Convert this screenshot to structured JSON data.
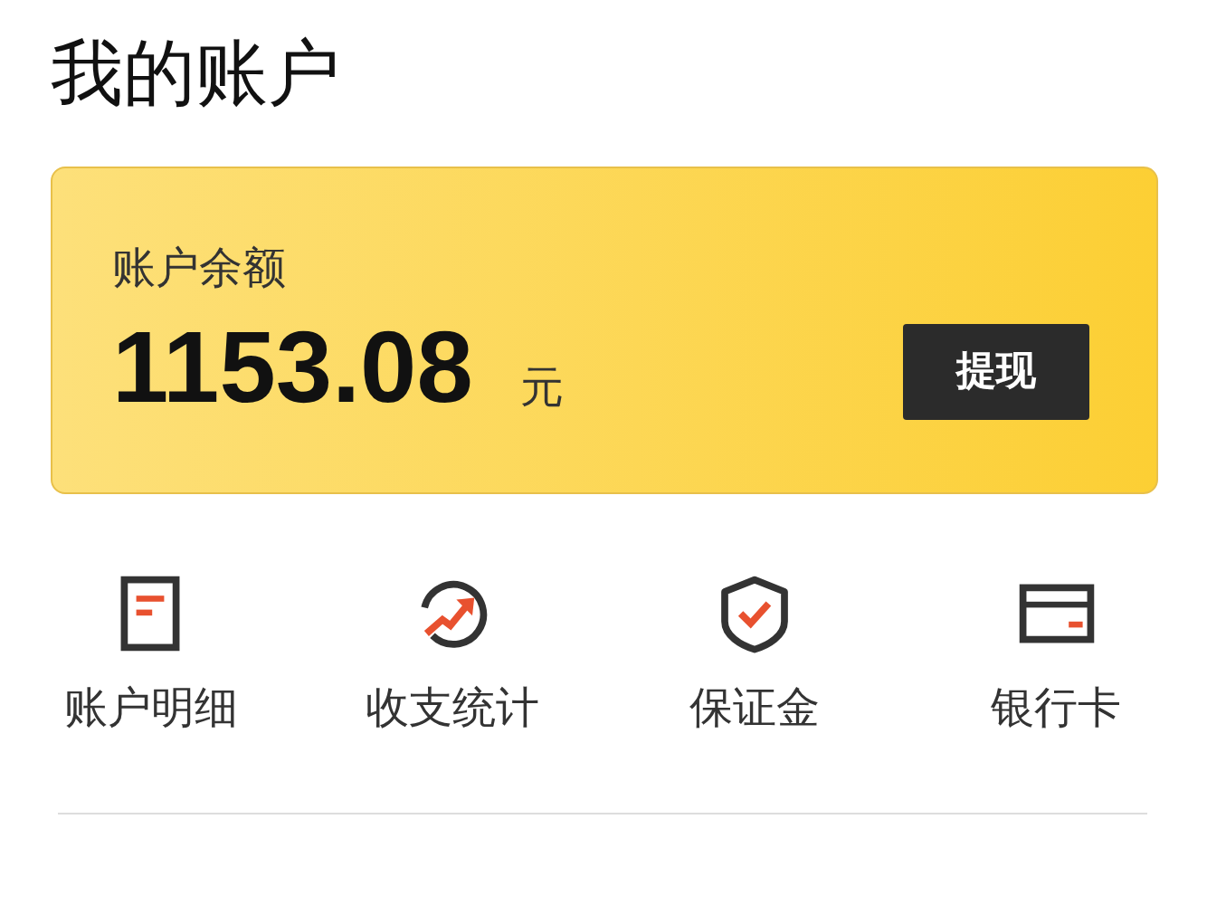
{
  "title": "我的账户",
  "balance": {
    "label": "账户余额",
    "amount": "1153.08",
    "unit": "元",
    "button": "提现"
  },
  "shortcuts": [
    {
      "kind": "document",
      "label": "账户明细"
    },
    {
      "kind": "trend",
      "label": "收支统计"
    },
    {
      "kind": "shield",
      "label": "保证金"
    },
    {
      "kind": "card",
      "label": "银行卡"
    }
  ]
}
